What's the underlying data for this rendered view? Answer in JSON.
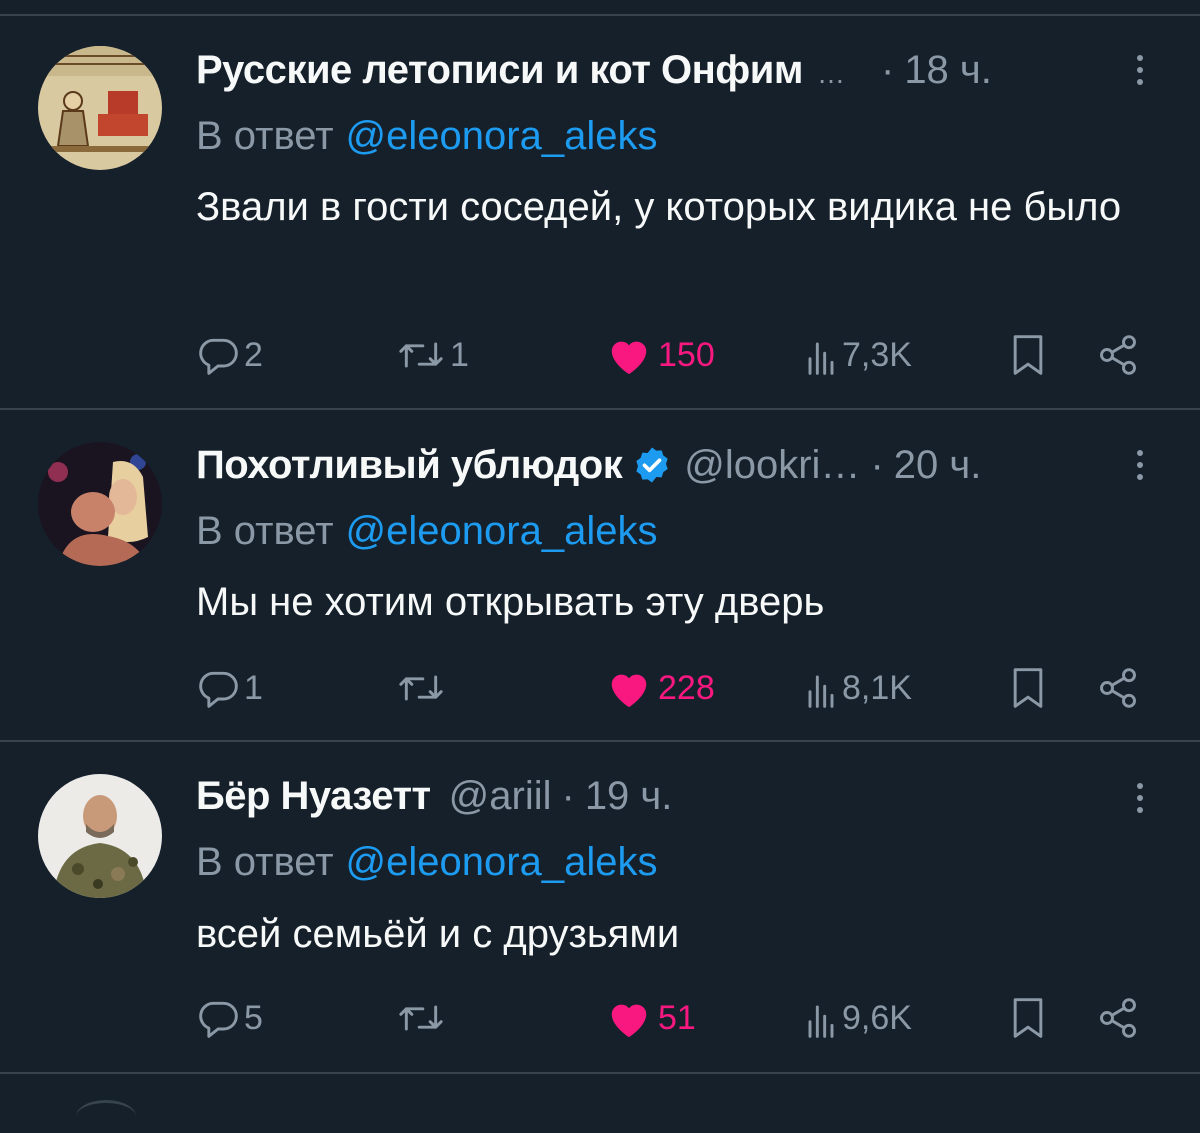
{
  "tweets": [
    {
      "name": "Русские летописи и кот Онфим",
      "name_truncation": "…",
      "handle": "",
      "verified": false,
      "time": "18 ч.",
      "reply_prefix": "В ответ",
      "reply_to": "@eleonora_aleks",
      "text": "Звали в гости соседей, у которых видика не было",
      "replies": "2",
      "retweets": "1",
      "likes": "150",
      "views": "7,3K"
    },
    {
      "name": "Похотливый ублюдок",
      "name_truncation": "",
      "handle": "@lookri…",
      "verified": true,
      "time": "20 ч.",
      "reply_prefix": "В ответ",
      "reply_to": "@eleonora_aleks",
      "text": "Мы не хотим открывать эту дверь",
      "replies": "1",
      "retweets": "",
      "likes": "228",
      "views": "8,1K"
    },
    {
      "name": "Бёр Нуазетт",
      "name_truncation": "",
      "handle": "@ariil",
      "verified": false,
      "time": "19 ч.",
      "reply_prefix": "В ответ",
      "reply_to": "@eleonora_aleks",
      "text": "всей семьёй и с друзьями",
      "replies": "5",
      "retweets": "",
      "likes": "51",
      "views": "9,6K"
    }
  ],
  "separator": "·",
  "colors": {
    "background": "#15202b",
    "divider": "#38444d",
    "text_primary": "#f7f9f9",
    "text_secondary": "#8b98a5",
    "mention": "#1d9bf0",
    "like": "#f91880",
    "verified": "#1d9bf0"
  },
  "icons": [
    "reply-icon",
    "retweet-icon",
    "heart-icon",
    "views-icon",
    "bookmark-icon",
    "share-icon",
    "more-icon",
    "verified-badge-icon"
  ]
}
